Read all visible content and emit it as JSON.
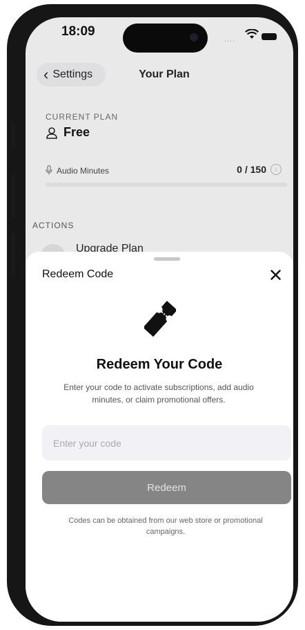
{
  "status_bar": {
    "time": "18:09",
    "signal": "....",
    "icons": [
      "wifi-icon",
      "battery-icon"
    ]
  },
  "nav": {
    "back_label": "Settings",
    "title": "Your Plan",
    "icons": [
      "chevron-left-icon"
    ]
  },
  "plan": {
    "section_label": "CURRENT PLAN",
    "name": "Free",
    "usage": {
      "label": "Audio Minutes",
      "value_text": "0 / 150",
      "used": 0,
      "total": 150
    },
    "icons": [
      "user-icon",
      "microphone-icon",
      "info-icon"
    ]
  },
  "actions": {
    "section_label": "ACTIONS",
    "items": [
      {
        "label": "Upgrade Plan"
      }
    ]
  },
  "sheet": {
    "title": "Redeem Code",
    "heading": "Redeem Your Code",
    "description": "Enter your code to activate subscriptions, add audio minutes, or claim promotional offers.",
    "input": {
      "placeholder": "Enter your code",
      "value": ""
    },
    "button_label": "Redeem",
    "footnote": "Codes can be obtained from our web store or promotional campaigns.",
    "icons": [
      "close-icon",
      "ticket-icon"
    ]
  },
  "colors": {
    "button_disabled": "#858585",
    "input_bg": "#f1f1f6",
    "overlay_bg": "#e9e9ea"
  }
}
